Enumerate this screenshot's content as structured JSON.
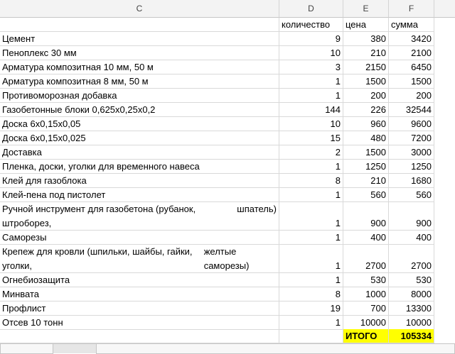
{
  "columns": {
    "c": "C",
    "d": "D",
    "e": "E",
    "f": "F"
  },
  "header_row": {
    "qty": "количество",
    "price": "цена",
    "sum": "сумма"
  },
  "rows": [
    {
      "name": "Цемент",
      "qty": "9",
      "price": "380",
      "sum": "3420"
    },
    {
      "name": "Пеноплекс 30 мм",
      "qty": "10",
      "price": "210",
      "sum": "2100"
    },
    {
      "name": "Арматура композитная 10 мм, 50 м",
      "qty": "3",
      "price": "2150",
      "sum": "6450"
    },
    {
      "name": "Арматура композитная 8 мм, 50 м",
      "qty": "1",
      "price": "1500",
      "sum": "1500"
    },
    {
      "name": "Противоморозная добавка",
      "qty": "1",
      "price": "200",
      "sum": "200"
    },
    {
      "name": "Газобетонные блоки 0,625х0,25х0,2",
      "qty": "144",
      "price": "226",
      "sum": "32544"
    },
    {
      "name": "Доска 6х0,15х0,05",
      "qty": "10",
      "price": "960",
      "sum": "9600"
    },
    {
      "name": "Доска 6х0,15х0,025",
      "qty": "15",
      "price": "480",
      "sum": "7200"
    },
    {
      "name": "Доставка",
      "qty": "2",
      "price": "1500",
      "sum": "3000"
    },
    {
      "name": "Пленка, доски, уголки для временного навеса",
      "qty": "1",
      "price": "1250",
      "sum": "1250"
    },
    {
      "name": "Клей для газоблока",
      "qty": "8",
      "price": "210",
      "sum": "1680"
    },
    {
      "name": "Клей-пена под пистолет",
      "qty": "1",
      "price": "560",
      "sum": "560"
    },
    {
      "name_line1": "Ручной инструмент для газобетона (рубанок, штроборез,",
      "name_line2": "шпатель)",
      "qty": "1",
      "price": "900",
      "sum": "900"
    },
    {
      "name": "Саморезы",
      "qty": "1",
      "price": "400",
      "sum": "400"
    },
    {
      "name_line1": "Крепеж для кровли (шпильки, шайбы, гайки, уголки,",
      "name_line2": "желтые саморезы)",
      "qty": "1",
      "price": "2700",
      "sum": "2700"
    },
    {
      "name": "Огнебиозащита",
      "qty": "1",
      "price": "530",
      "sum": "530"
    },
    {
      "name": "Минвата",
      "qty": "8",
      "price": "1000",
      "sum": "8000"
    },
    {
      "name": "Профлист",
      "qty": "19",
      "price": "700",
      "sum": "13300"
    },
    {
      "name": "Отсев 10 тонн",
      "qty": "1",
      "price": "10000",
      "sum": "10000"
    }
  ],
  "total": {
    "label": "ИТОГО",
    "value": "105334"
  },
  "colors": {
    "total_bg": "#ffff00",
    "header_bg": "#f3f3f3",
    "gridline": "#d9d9d9"
  }
}
